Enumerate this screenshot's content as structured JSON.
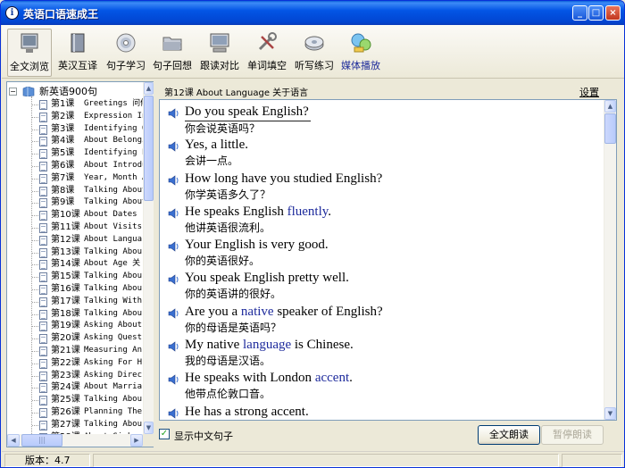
{
  "window": {
    "title": "英语口语速成王",
    "controls": {
      "minimize": "_",
      "maximize": "□",
      "close": "×"
    }
  },
  "toolbar": {
    "tools": [
      {
        "label": "全文浏览",
        "icon": "monitor-icon"
      },
      {
        "label": "英汉互译",
        "icon": "book-icon"
      },
      {
        "label": "句子学习",
        "icon": "cd-icon"
      },
      {
        "label": "句子回想",
        "icon": "folder-icon"
      },
      {
        "label": "跟读对比",
        "icon": "computer-icon"
      },
      {
        "label": "单词填空",
        "icon": "tools-icon"
      },
      {
        "label": "听写练习",
        "icon": "disk-icon"
      },
      {
        "label": "媒体播放",
        "icon": "media-icon"
      }
    ]
  },
  "tree": {
    "root": "新英语900句",
    "items": [
      {
        "num": "第1课",
        "name": "Greetings 问候"
      },
      {
        "num": "第2课",
        "name": "Expression In"
      },
      {
        "num": "第3课",
        "name": "Identifying O"
      },
      {
        "num": "第4课",
        "name": "About Belongi"
      },
      {
        "num": "第5课",
        "name": "Identifying P"
      },
      {
        "num": "第6课",
        "name": "About Introdu"
      },
      {
        "num": "第7课",
        "name": "Year, Month A"
      },
      {
        "num": "第8课",
        "name": "Talking About"
      },
      {
        "num": "第9课",
        "name": "Talking About"
      },
      {
        "num": "第10课",
        "name": "About Dates"
      },
      {
        "num": "第11课",
        "name": "About Visits"
      },
      {
        "num": "第12课",
        "name": "About Langua"
      },
      {
        "num": "第13课",
        "name": "Talking Abou"
      },
      {
        "num": "第14课",
        "name": "About Age 关"
      },
      {
        "num": "第15课",
        "name": "Talking Abou"
      },
      {
        "num": "第16课",
        "name": "Talking Abou"
      },
      {
        "num": "第17课",
        "name": "Talking With"
      },
      {
        "num": "第18课",
        "name": "Talking Abou"
      },
      {
        "num": "第19课",
        "name": "Asking About"
      },
      {
        "num": "第20课",
        "name": "Asking Quest"
      },
      {
        "num": "第21课",
        "name": "Measuring An"
      },
      {
        "num": "第22课",
        "name": "Asking For H"
      },
      {
        "num": "第23课",
        "name": "Asking Direc"
      },
      {
        "num": "第24课",
        "name": "About Marria"
      },
      {
        "num": "第25课",
        "name": "Talking Abou"
      },
      {
        "num": "第26课",
        "name": "Planning The"
      },
      {
        "num": "第27课",
        "name": "Talking Abou"
      },
      {
        "num": "第28课",
        "name": "About Sickne"
      }
    ]
  },
  "content": {
    "lesson_title": "第12课 About Language 关于语言",
    "settings": "设置",
    "sentences": [
      {
        "en": [
          "Do you speak English?"
        ],
        "zh": "你会说英语吗？"
      },
      {
        "en": [
          "Yes, a little."
        ],
        "zh": "会讲一点。"
      },
      {
        "en": [
          "How long have you studied English?"
        ],
        "zh": "你学英语多久了？"
      },
      {
        "en": [
          "He speaks English ",
          "fluently",
          "."
        ],
        "zh": "他讲英语很流利。"
      },
      {
        "en": [
          "Your English is very good."
        ],
        "zh": "你的英语很好。"
      },
      {
        "en": [
          "You speak English pretty well."
        ],
        "zh": "你的英语讲的很好。"
      },
      {
        "en": [
          "Are you a ",
          "native",
          " speaker of English?"
        ],
        "zh": "你的母语是英语吗？"
      },
      {
        "en": [
          "My native ",
          "language",
          " is Chinese."
        ],
        "zh": "我的母语是汉语。"
      },
      {
        "en": [
          "He speaks with London ",
          "accent",
          "."
        ],
        "zh": "他带点伦敦口音。"
      },
      {
        "en": [
          "He has a strong accent."
        ],
        "zh": ""
      }
    ]
  },
  "bottom": {
    "checkbox_label": "显示中文句子",
    "read_all": "全文朗读",
    "pause_read": "暂停朗读"
  },
  "status": {
    "version": "版本：4.7"
  }
}
